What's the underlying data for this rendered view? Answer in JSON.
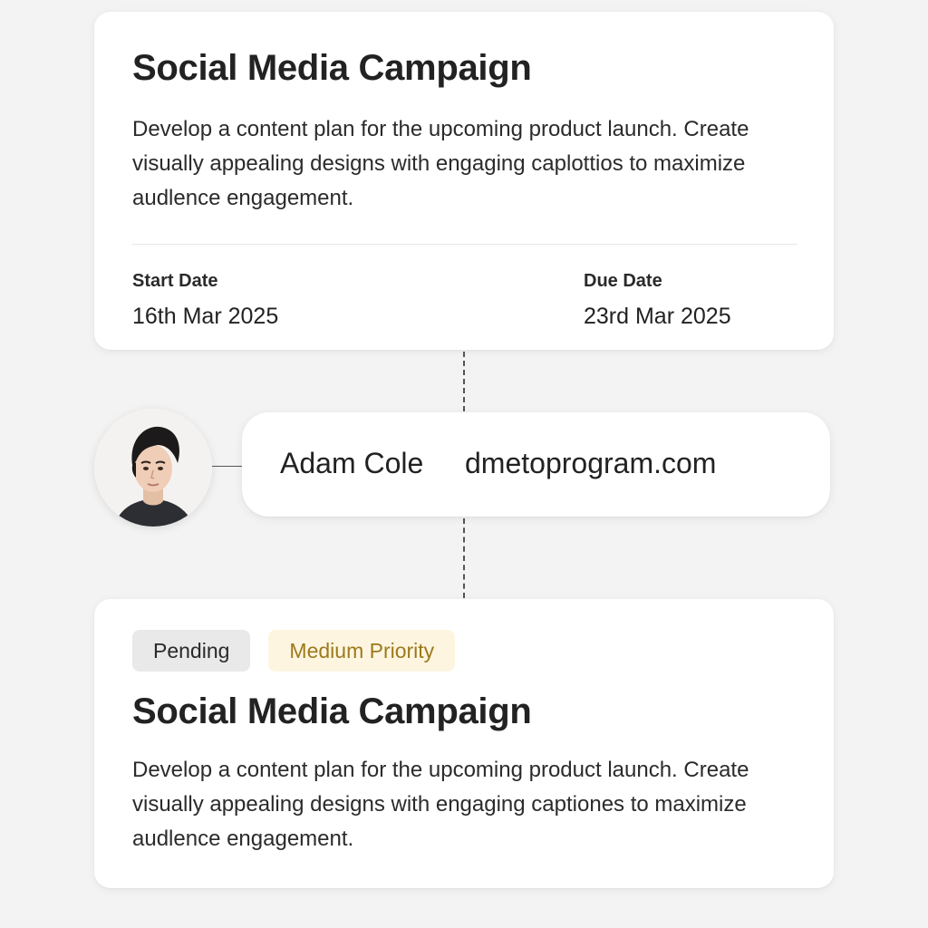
{
  "task_card": {
    "title": "Social Media Campaign",
    "description": "Develop a content plan for the upcoming product launch. Create visually appealing designs with engaging caplottios to maximize audlence engagement.",
    "start_date_label": "Start Date",
    "start_date_value": "16th Mar 2025",
    "due_date_label": "Due Date",
    "due_date_value": "23rd Mar 2025"
  },
  "assignee": {
    "name": "Adam Cole",
    "email": "dmetoprogram.com",
    "avatar_icon": "person-avatar"
  },
  "summary_card": {
    "status_badge": "Pending",
    "priority_badge": "Medium Priority",
    "title": "Social Media Campaign",
    "description": "Develop a content plan for the upcoming product launch. Create visually appealing designs with engaging captiones to maximize audlence engagement."
  },
  "colors": {
    "background": "#f3f3f3",
    "card": "#ffffff",
    "status_badge_bg": "#e9e9e9",
    "priority_badge_bg": "#fdf5e0",
    "priority_badge_text": "#9c7a1c"
  }
}
